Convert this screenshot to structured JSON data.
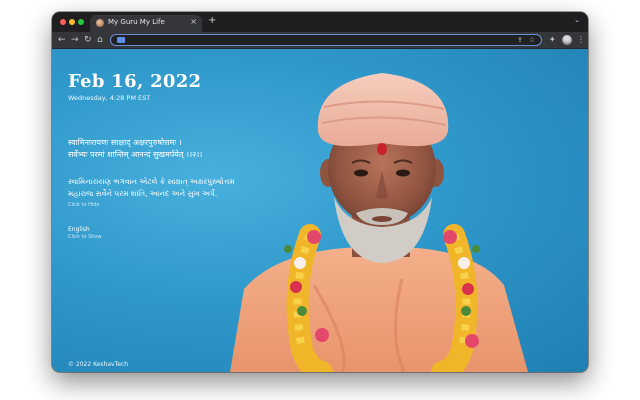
{
  "browser": {
    "tab_title": "My Guru My Life",
    "tab_close": "×",
    "new_tab": "+",
    "tab_menu": "⌄",
    "nav": {
      "back": "←",
      "forward": "→",
      "reload": "↻",
      "home": "⌂"
    },
    "omnibox": {
      "share": "⇪",
      "star": "☆"
    },
    "toolbar": {
      "extensions": "✦",
      "side_panel": "▤",
      "menu": "⋮"
    },
    "traffic_lights": [
      "#ff5f57",
      "#febc2e",
      "#28c840"
    ]
  },
  "page": {
    "date": "Feb 16, 2022",
    "datetime": "Wednesday, 4:28 PM EST",
    "sanskrit_line1": "स्वामिनारायणः साक्षाद् अक्षरपुरुषोत्तमः ।",
    "sanskrit_line2": "सर्वेभ्यः परमां शान्तिम् आनन्दं सुखमर्पयेत् ।।२।।",
    "gujarati_line1": "સ્વામિનારાયણ ભગવાન એટલે કે સાક્ષાત્ અક્ષરપુરુષોત્તમ",
    "gujarati_line2": "મહારાજ સર્વેને પરમ શાંતિ, આનંદ અને સુખ અર્પે.",
    "hide_link": "Click to Hide",
    "language": "English",
    "show_link": "Click to Show",
    "copyright": "© 2022 KeshavTech"
  },
  "colors": {
    "background_blue": "#2f98cb",
    "robe_orange": "#f0a27c",
    "turban_pink": "#f3c2b0"
  }
}
